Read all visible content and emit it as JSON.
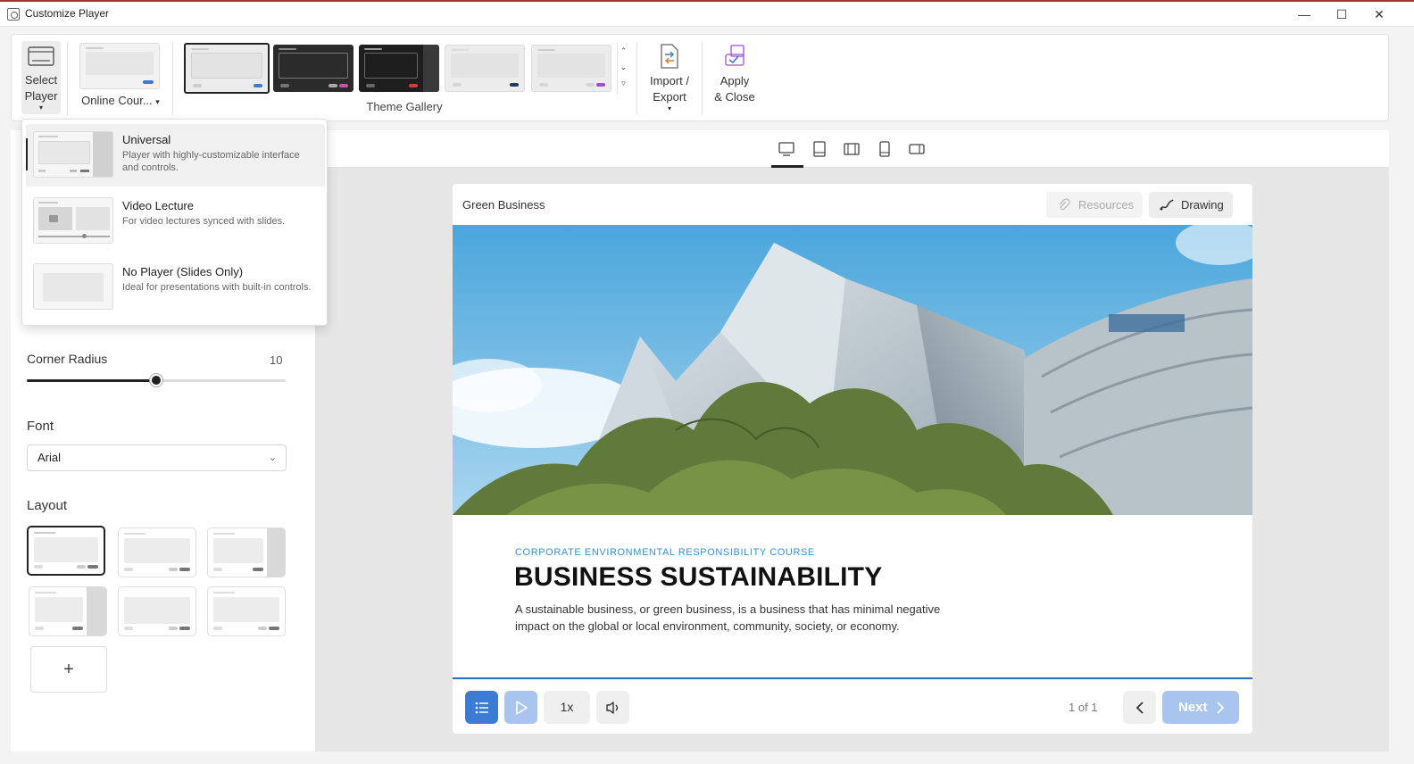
{
  "window": {
    "title": "Customize Player",
    "minimize": "—",
    "maximize": "☐",
    "close": "✕"
  },
  "ribbon": {
    "select_player_line1": "Select",
    "select_player_line2": "Player",
    "template_label": "Online Cour...",
    "theme_gallery_label": "Theme Gallery",
    "import_export_line1": "Import /",
    "import_export_line2": "Export",
    "apply_close_line1": "Apply",
    "apply_close_line2": "& Close",
    "themes": [
      {
        "name": "light-blue",
        "bg": "#ececec",
        "accent": "#3a7bd5"
      },
      {
        "name": "dark-pink",
        "bg": "#2b2b2b",
        "accent": "#c64fb0"
      },
      {
        "name": "dark-red",
        "bg": "#1e1e1e",
        "accent": "#d63a3a"
      },
      {
        "name": "light-navy",
        "bg": "#ececec",
        "accent": "#1f3b57"
      },
      {
        "name": "light-purple",
        "bg": "#ececec",
        "accent": "#a14fd6"
      }
    ]
  },
  "player_menu": {
    "items": [
      {
        "title": "Universal",
        "desc": "Player with highly-customizable interface and controls."
      },
      {
        "title": "Video Lecture",
        "desc": "For video lectures synced with slides."
      },
      {
        "title": "No Player (Slides Only)",
        "desc": "Ideal for presentations with built-in controls."
      }
    ]
  },
  "sidebar": {
    "corner_radius_label": "Corner Radius",
    "corner_radius_value": "10",
    "corner_radius_fraction": 0.5,
    "font_label": "Font",
    "font_value": "Arial",
    "layout_label": "Layout",
    "add_symbol": "+"
  },
  "player": {
    "course_name": "Green Business",
    "resources_label": "Resources",
    "drawing_label": "Drawing",
    "slide_subtitle": "CORPORATE ENVIRONMENTAL RESPONSIBILITY COURSE",
    "slide_title": "BUSINESS SUSTAINABILITY",
    "slide_body": "A sustainable business, or green business, is a business that has minimal negative impact on the global or local environment, community, society, or economy.",
    "speed_label": "1x",
    "page_indicator": "1 of 1",
    "next_label": "Next"
  },
  "colors": {
    "accent_blue": "#3a7bd5",
    "disabled_blue": "#a9c4ee"
  }
}
